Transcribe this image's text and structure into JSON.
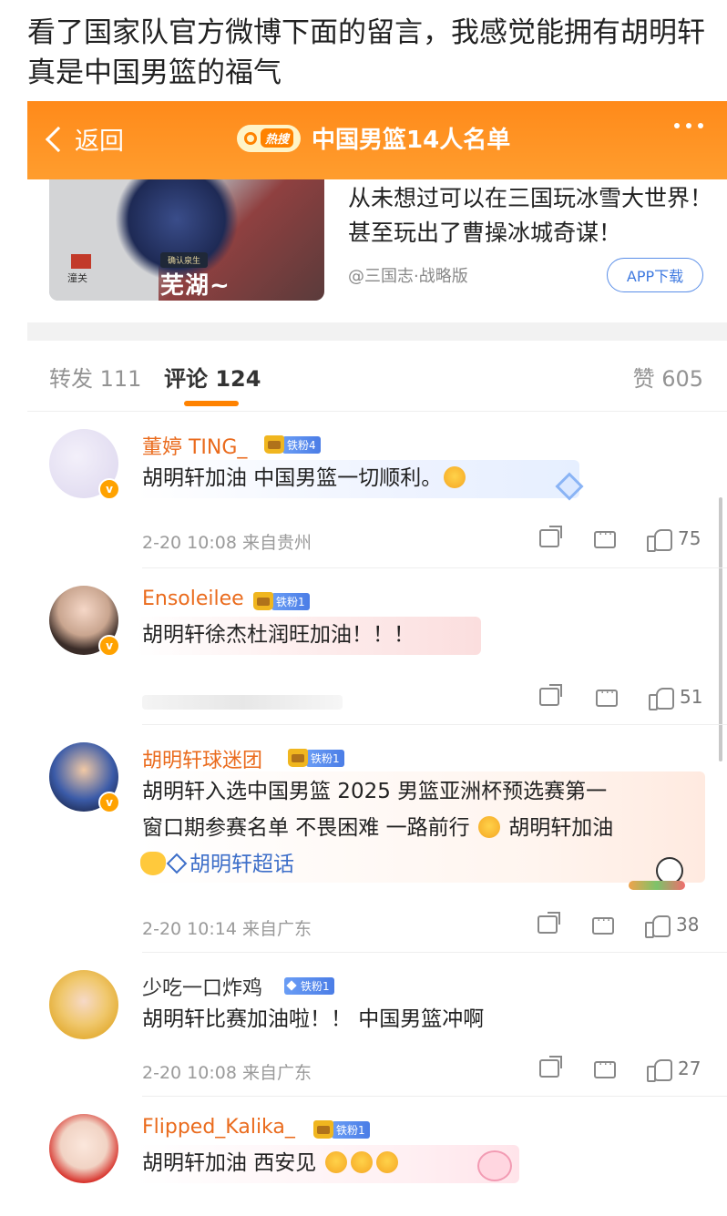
{
  "caption": "看了国家队官方微博下面的留言，我感觉能拥有胡明轩真是中国男篮的福气",
  "topbar": {
    "back_label": "返回",
    "hot_tag": "热搜",
    "title": "中国男篮14人名单"
  },
  "ad": {
    "text": "从未想过可以在三国玩冰雪大世界！甚至玩出了曹操冰城奇谋！",
    "source": "@三国志·战略版",
    "button": "APP下载",
    "image_label_small": "确认泉生",
    "image_label_big": "芜湖~",
    "image_place": "潼关"
  },
  "tabs": {
    "repost": "转发 111",
    "comment": "评论 124",
    "like": "赞 605"
  },
  "comments": [
    {
      "name": "董婷 TING_",
      "fan": "铁粉4",
      "text": "胡明轩加油 中国男篮一切顺利。",
      "time": "2-20 10:08 来自贵州",
      "likes": "75"
    },
    {
      "name": "Ensoleilee",
      "fan": "铁粉1",
      "text": "胡明轩徐杰杜润旺加油！！！",
      "time": "",
      "likes": "51"
    },
    {
      "name": "胡明轩球迷团",
      "fan": "铁粉1",
      "text_line1": "胡明轩入选中国男篮 2025 男篮亚洲杯预选赛第一",
      "text_line2": "窗口期参赛名单 不畏困难 一路前行",
      "text_line2b": "胡明轩加油",
      "topic": "胡明轩超话",
      "time": "2-20 10:14 来自广东",
      "likes": "38"
    },
    {
      "name": "少吃一口炸鸡",
      "fan": "铁粉1",
      "text": "胡明轩比赛加油啦！！ 中国男篮冲啊",
      "time": "2-20 10:08 来自广东",
      "likes": "27"
    },
    {
      "name": "Flipped_Kalika_",
      "fan": "铁粉1",
      "text": "胡明轩加油 西安见",
      "time": "",
      "likes": ""
    }
  ],
  "colors": {
    "accent": "#ff8200",
    "name_orange": "#ea6b1d",
    "name_plain": "#333333",
    "link_blue": "#3e6fc9"
  }
}
